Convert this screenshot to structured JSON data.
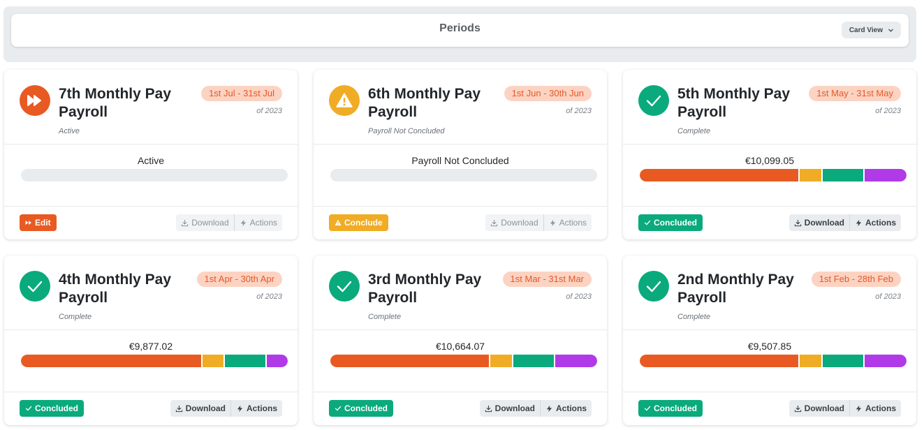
{
  "header": {
    "title": "Periods",
    "view_label": "Card View"
  },
  "colors": {
    "orange": "#e85a22",
    "yellow": "#f0ac24",
    "green": "#0aaa7c",
    "purple": "#b03ae8"
  },
  "cards": [
    {
      "title": "7th Monthly Pay Payroll",
      "status": "Active",
      "status_icon": "fast-forward-icon",
      "dates": "1st Jul - 31st Jul",
      "year": "of 2023",
      "mid_label": "Active",
      "breakdown": [],
      "primary_label": "Edit",
      "download_label": "Download",
      "actions_label": "Actions"
    },
    {
      "title": "6th Monthly Pay Payroll",
      "status": "Payroll Not Concluded",
      "status_icon": "warning-icon",
      "dates": "1st Jun - 30th Jun",
      "year": "of 2023",
      "mid_label": "Payroll Not Concluded",
      "breakdown": [],
      "primary_label": "Conclude",
      "download_label": "Download",
      "actions_label": "Actions"
    },
    {
      "title": "5th Monthly Pay Payroll",
      "status": "Complete",
      "status_icon": "check-icon",
      "dates": "1st May - 31st May",
      "year": "of 2023",
      "mid_label": "€10,099.05",
      "breakdown": [
        0.605,
        0.08,
        0.155,
        0.16
      ],
      "primary_label": "Concluded",
      "download_label": "Download",
      "actions_label": "Actions"
    },
    {
      "title": "4th Monthly Pay Payroll",
      "status": "Complete",
      "status_icon": "check-icon",
      "dates": "1st Apr - 30th Apr",
      "year": "of 2023",
      "mid_label": "€9,877.02",
      "breakdown": [
        0.685,
        0.08,
        0.155,
        0.08
      ],
      "primary_label": "Concluded",
      "download_label": "Download",
      "actions_label": "Actions"
    },
    {
      "title": "3rd Monthly Pay Payroll",
      "status": "Complete",
      "status_icon": "check-icon",
      "dates": "1st Mar - 31st Mar",
      "year": "of 2023",
      "mid_label": "€10,664.07",
      "breakdown": [
        0.605,
        0.08,
        0.155,
        0.16
      ],
      "primary_label": "Concluded",
      "download_label": "Download",
      "actions_label": "Actions"
    },
    {
      "title": "2nd Monthly Pay Payroll",
      "status": "Complete",
      "status_icon": "check-icon",
      "dates": "1st Feb - 28th Feb",
      "year": "of 2023",
      "mid_label": "€9,507.85",
      "breakdown": [
        0.605,
        0.08,
        0.155,
        0.16
      ],
      "primary_label": "Concluded",
      "download_label": "Download",
      "actions_label": "Actions"
    }
  ]
}
